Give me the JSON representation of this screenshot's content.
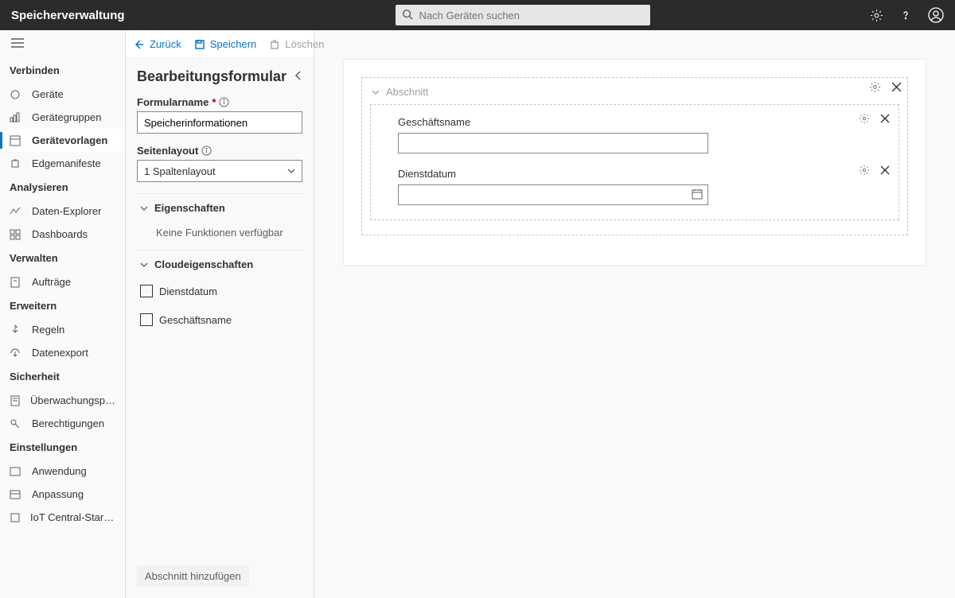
{
  "topbar": {
    "title": "Speicherverwaltung",
    "search_placeholder": "Nach Geräten suchen"
  },
  "sidebar": {
    "sections": [
      {
        "header": "Verbinden",
        "items": [
          {
            "label": "Geräte"
          },
          {
            "label": "Gerätegruppen"
          },
          {
            "label": "Gerätevorlagen",
            "active": true
          },
          {
            "label": "Edgemanifeste"
          }
        ]
      },
      {
        "header": "Analysieren",
        "items": [
          {
            "label": "Daten-Explorer"
          },
          {
            "label": "Dashboards"
          }
        ]
      },
      {
        "header": "Verwalten",
        "items": [
          {
            "label": "Aufträge"
          }
        ]
      },
      {
        "header": "Erweitern",
        "items": [
          {
            "label": "Regeln"
          },
          {
            "label": "Datenexport"
          }
        ]
      },
      {
        "header": "Sicherheit",
        "items": [
          {
            "label": "Überwachungsproto…"
          },
          {
            "label": "Berechtigungen"
          }
        ]
      },
      {
        "header": "Einstellungen",
        "items": [
          {
            "label": "Anwendung"
          },
          {
            "label": "Anpassung"
          },
          {
            "label": "IoT Central-Startseite"
          }
        ]
      }
    ]
  },
  "commands": {
    "back": "Zurück",
    "save": "Speichern",
    "delete": "Löschen"
  },
  "editor": {
    "title": "Bearbeitungsformular",
    "form_name_label": "Formularname",
    "form_name_value": "Speicherinformationen",
    "layout_label": "Seitenlayout",
    "layout_value": "1 Spaltenlayout",
    "group_properties": "Eigenschaften",
    "no_functions": "Keine Funktionen verfügbar",
    "group_cloud": "Cloudeigenschaften",
    "cb_service_date": "Dienstdatum",
    "cb_business_name": "Geschäftsname",
    "add_section": "Abschnitt hinzufügen"
  },
  "canvas": {
    "section_label": "Abschnitt",
    "field_business": "Geschäftsname",
    "field_service": "Dienstdatum"
  }
}
